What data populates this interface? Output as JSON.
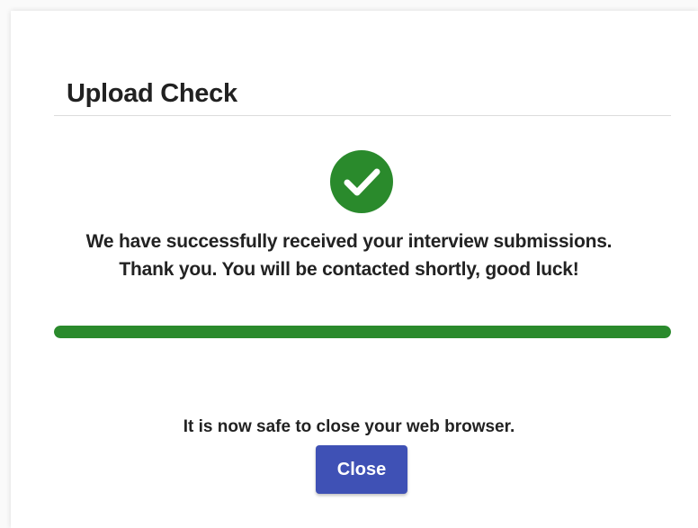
{
  "dialog": {
    "title": "Upload Check",
    "message_line_1": "We have successfully received your interview submissions.",
    "message_line_2": "Thank you. You will be contacted shortly, good luck!",
    "progress_percent": 100,
    "safe_text": "It is now safe to close your web browser.",
    "close_label": "Close",
    "icon": "check-circle-icon"
  },
  "colors": {
    "success": "#2a8a2c",
    "primary_button": "#3f51b5"
  }
}
